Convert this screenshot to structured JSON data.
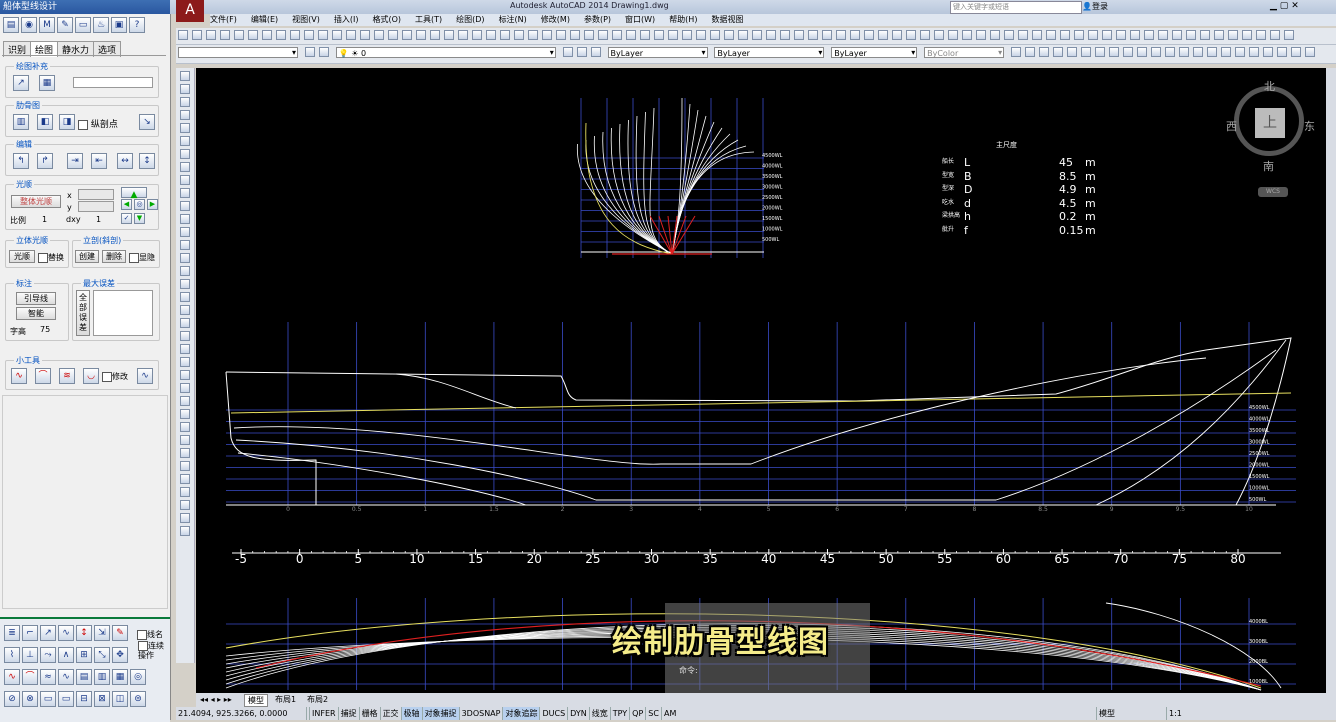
{
  "plugin": {
    "title": "船体型线设计",
    "tabs": [
      "识别",
      "绘图",
      "静水力",
      "选项"
    ],
    "active_tab": "绘图",
    "groups": {
      "drawing_fill": "绘图补充",
      "rib_plan": "肋骨图",
      "rib_plan_check": "纵剖点",
      "edit": "编辑",
      "fairing": "光顺",
      "fairing_btn": "整体光顺",
      "x_label": "x",
      "y_label": "y",
      "scale_label": "比例",
      "scale_value": "1",
      "dxy_label": "dxy",
      "dxy_value": "1",
      "solid": "立体光顺",
      "solid_btn": "光顺",
      "solid_replace": "替换",
      "elev": "立剖(斜剖)",
      "elev_create": "创建",
      "elev_delete": "删除",
      "elev_hide": "显隐",
      "mark": "标注",
      "lead_btn": "引导线",
      "smart_btn": "智能",
      "text_height_label": "字高",
      "text_height_value": "75",
      "max_error": "最大误差",
      "all_error_btn": "全部误差",
      "tools": "小工具",
      "tools_modify": "修改",
      "line_name": "线名",
      "continuous_op": "连续操作"
    }
  },
  "cad": {
    "title": "Autodesk AutoCAD 2014    Drawing1.dwg",
    "search_placeholder": "键入关键字或短语",
    "login": "登录",
    "menu": [
      "文件(F)",
      "编辑(E)",
      "视图(V)",
      "插入(I)",
      "格式(O)",
      "工具(T)",
      "绘图(D)",
      "标注(N)",
      "修改(M)",
      "参数(P)",
      "窗口(W)",
      "帮助(H)",
      "数据视图"
    ],
    "layer_value": "0",
    "color_value": "ByLayer",
    "linetype_value": "ByLayer",
    "lineweight_value": "ByLayer",
    "plotstyle_value": "ByColor",
    "viewcube": {
      "north": "北",
      "south": "南",
      "east": "东",
      "west": "西",
      "top": "上",
      "wcs": "WCS"
    },
    "layout_tabs": [
      "模型",
      "布局1",
      "布局2"
    ],
    "coords": "21.4094, 925.3266, 0.0000",
    "status_items": [
      "INFER",
      "捕捉",
      "栅格",
      "正交",
      "极轴",
      "对象捕捉",
      "3DOSNAP",
      "对象追踪",
      "DUCS",
      "DYN",
      "线宽",
      "TPY",
      "QP",
      "SC",
      "AM"
    ],
    "model_label": "模型",
    "scale_readout": "1:1"
  },
  "drawing": {
    "principal_dims": {
      "heading": "主尺度",
      "rows": [
        {
          "label": "船长",
          "sym": "L",
          "value": "45",
          "unit": "m"
        },
        {
          "label": "型宽",
          "sym": "B",
          "value": "8.5",
          "unit": "m"
        },
        {
          "label": "型深",
          "sym": "D",
          "value": "4.9",
          "unit": "m"
        },
        {
          "label": "吃水",
          "sym": "d",
          "value": "4.5",
          "unit": "m"
        },
        {
          "label": "梁拱高",
          "sym": "h",
          "value": "0.2",
          "unit": "m"
        },
        {
          "label": "舭升",
          "sym": "f",
          "value": "0.15",
          "unit": "m"
        }
      ]
    },
    "ruler_ticks": [
      "-5",
      "0",
      "5",
      "10",
      "15",
      "20",
      "25",
      "30",
      "35",
      "40",
      "45",
      "50",
      "55",
      "60",
      "65",
      "70",
      "75",
      "80"
    ],
    "body_wl_labels": [
      "4500WL",
      "4000WL",
      "3500WL",
      "3000WL",
      "2500WL",
      "2000WL",
      "1500WL",
      "1000WL",
      "500WL"
    ],
    "profile_wl_labels": [
      "4500WL",
      "4000WL",
      "3500WL",
      "3000WL",
      "2500WL",
      "2000WL",
      "1500WL",
      "1000WL",
      "500WL"
    ],
    "station_labels": [
      "0",
      "0.5",
      "1",
      "1.5",
      "2",
      "3",
      "4",
      "5",
      "6",
      "7",
      "8",
      "8.5",
      "9",
      "9.5",
      "10"
    ],
    "plan_bl_labels": [
      "4000BL",
      "3000BL",
      "2000BL",
      "1000BL"
    ],
    "cmd_text": "命令:"
  },
  "overlay": {
    "caption": "绘制肋骨型线图"
  },
  "colors": {
    "background": "#000000",
    "line": "#ffffff",
    "grid": "#3a4cc8",
    "yellow": "#e8e060",
    "red": "#e02020",
    "caption": "#f5ec8a"
  }
}
